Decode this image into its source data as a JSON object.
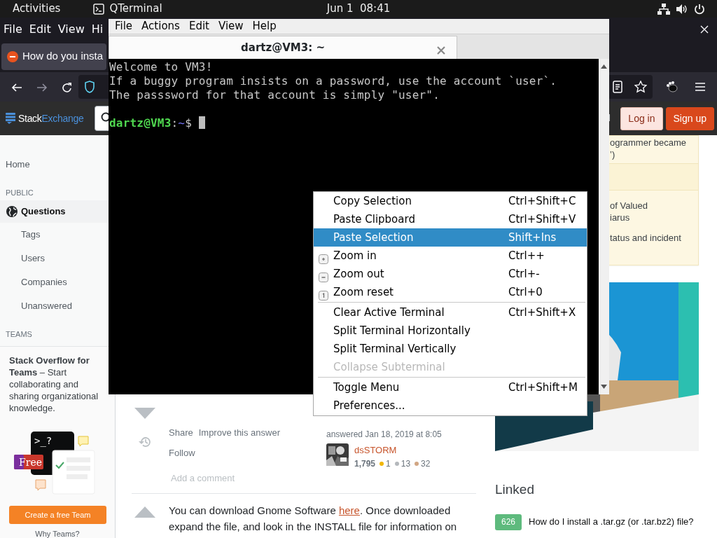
{
  "top_bar": {
    "activities": "Activities",
    "app": "QTerminal",
    "clock": "Jun 1  08:41"
  },
  "browser": {
    "menu": [
      "File",
      "Edit",
      "View",
      "Hi"
    ],
    "tab": {
      "title": "How do you insta"
    },
    "site": {
      "logo": [
        "Stack",
        "Exchange"
      ],
      "login": "Log in",
      "signup": "Sign up"
    },
    "sidebar": [
      {
        "kind": "link",
        "label": "Home",
        "selected": false
      },
      {
        "kind": "heading",
        "label": "PUBLIC"
      },
      {
        "kind": "main",
        "label": "Questions",
        "selected": true
      },
      {
        "kind": "sub",
        "label": "Tags",
        "selected": false
      },
      {
        "kind": "sub",
        "label": "Users",
        "selected": false
      },
      {
        "kind": "sub",
        "label": "Companies",
        "selected": false
      },
      {
        "kind": "sub",
        "label": "Unanswered",
        "selected": false
      },
      {
        "kind": "heading",
        "label": "TEAMS"
      }
    ],
    "teams": {
      "text": "**Stack Overflow for Teams** – Start collaborating and sharing organizational knowledge.",
      "prompt": ">_?",
      "badge": "Free",
      "button": "Create a free Team",
      "link": "Why Teams?"
    },
    "answer": {
      "actions": [
        "Share",
        "Improve this answer"
      ],
      "follow": "Follow",
      "answered": "answered Jan 18, 2019 at 8:05",
      "user": {
        "name": "dsSTORM",
        "reputation": "1,795",
        "badges": [
          {
            "count": "1",
            "color": "#f1b600"
          },
          {
            "count": "13",
            "color": "#b4b8bc"
          },
          {
            "count": "32",
            "color": "#d1a684"
          }
        ]
      },
      "add_comment": "Add a comment"
    },
    "next_answer": {
      "before": "You can download Gnome Software ",
      "link": "here",
      "after": ". Once downloaded expand the file, and look in the INSTALL file for information on"
    },
    "promo": [
      {
        "kind": "item",
        "lines": [
          "ogrammer became",
          "’)"
        ]
      },
      {
        "kind": "header"
      },
      {
        "kind": "item",
        "lines": [
          "of Valued",
          "iarus"
        ]
      },
      {
        "kind": "item",
        "lines": [
          "tatus and incident"
        ]
      }
    ],
    "linked": {
      "title": "Linked",
      "items": [
        {
          "score": "626",
          "title": "How do I install a .tar.gz (or .tar.bz2) file?"
        }
      ]
    }
  },
  "terminal": {
    "menu": [
      "File",
      "Actions",
      "Edit",
      "View",
      "Help"
    ],
    "tab": {
      "title": "dartz@VM3: ~"
    },
    "lines": [
      "Welcome to VM3!",
      "If a buggy program insists on a password, use the account `user`.",
      "The passsword for that account is simply \"user\"."
    ],
    "prompt": {
      "user": "dartz@VM3",
      "sep": ":",
      "path": "~",
      "symbol": "$"
    }
  },
  "context_menu": [
    {
      "kind": "item",
      "label": "Copy Selection",
      "shortcut": "Ctrl+Shift+C",
      "selected": false,
      "disabled": false
    },
    {
      "kind": "item",
      "label": "Paste Clipboard",
      "shortcut": "Ctrl+Shift+V",
      "selected": false,
      "disabled": false
    },
    {
      "kind": "item",
      "label": "Paste Selection",
      "shortcut": "Shift+Ins",
      "selected": true,
      "disabled": false
    },
    {
      "kind": "zoomin",
      "label": "Zoom in",
      "shortcut": "Ctrl++",
      "selected": false,
      "disabled": false
    },
    {
      "kind": "zoomout",
      "label": "Zoom out",
      "shortcut": "Ctrl+-",
      "selected": false,
      "disabled": false
    },
    {
      "kind": "zoomreset",
      "label": "Zoom reset",
      "shortcut": "Ctrl+0",
      "selected": false,
      "disabled": false
    },
    {
      "kind": "separator"
    },
    {
      "kind": "item",
      "label": "Clear Active Terminal",
      "shortcut": "Ctrl+Shift+X",
      "selected": false,
      "disabled": false
    },
    {
      "kind": "item",
      "label": "Split Terminal Horizontally",
      "selected": false,
      "disabled": false
    },
    {
      "kind": "item",
      "label": "Split Terminal Vertically",
      "selected": false,
      "disabled": false
    },
    {
      "kind": "item",
      "label": "Collapse Subterminal",
      "selected": false,
      "disabled": true
    },
    {
      "kind": "separator"
    },
    {
      "kind": "item",
      "label": "Toggle Menu",
      "shortcut": "Ctrl+Shift+M",
      "selected": false,
      "disabled": false
    },
    {
      "kind": "item",
      "label": "Preferences...",
      "selected": false,
      "disabled": false
    }
  ]
}
